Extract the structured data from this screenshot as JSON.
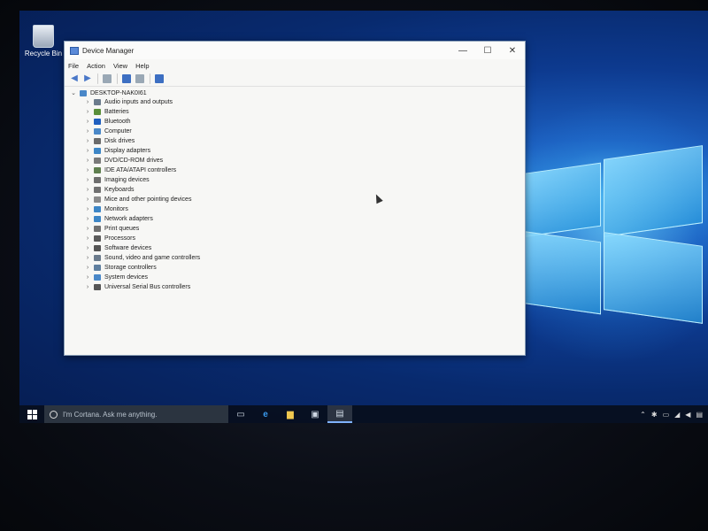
{
  "desktop": {
    "recycle_bin_label": "Recycle Bin"
  },
  "window": {
    "title": "Device Manager",
    "controls": {
      "minimize": "—",
      "maximize": "☐",
      "close": "✕"
    }
  },
  "menu": [
    "File",
    "Action",
    "View",
    "Help"
  ],
  "tree": {
    "root": "DESKTOP-NAK0I61",
    "items": [
      {
        "label": "Audio inputs and outputs",
        "icon": "speaker-icon",
        "color": "#6b7b8c"
      },
      {
        "label": "Batteries",
        "icon": "battery-icon",
        "color": "#5a8f3a"
      },
      {
        "label": "Bluetooth",
        "icon": "bluetooth-icon",
        "color": "#1f5fbf"
      },
      {
        "label": "Computer",
        "icon": "computer-icon",
        "color": "#4a88c8"
      },
      {
        "label": "Disk drives",
        "icon": "disk-icon",
        "color": "#6b6b6b"
      },
      {
        "label": "Display adapters",
        "icon": "display-icon",
        "color": "#3d86c6"
      },
      {
        "label": "DVD/CD-ROM drives",
        "icon": "dvd-icon",
        "color": "#7a7a7a"
      },
      {
        "label": "IDE ATA/ATAPI controllers",
        "icon": "ide-icon",
        "color": "#5f7f4f"
      },
      {
        "label": "Imaging devices",
        "icon": "camera-icon",
        "color": "#6d6d6d"
      },
      {
        "label": "Keyboards",
        "icon": "keyboard-icon",
        "color": "#707070"
      },
      {
        "label": "Mice and other pointing devices",
        "icon": "mouse-icon",
        "color": "#8a8a8a"
      },
      {
        "label": "Monitors",
        "icon": "monitor-icon",
        "color": "#3d86c6"
      },
      {
        "label": "Network adapters",
        "icon": "network-icon",
        "color": "#3d86c6"
      },
      {
        "label": "Print queues",
        "icon": "printer-icon",
        "color": "#707070"
      },
      {
        "label": "Processors",
        "icon": "processor-icon",
        "color": "#5a5a5a"
      },
      {
        "label": "Software devices",
        "icon": "software-icon",
        "color": "#555555"
      },
      {
        "label": "Sound, video and game controllers",
        "icon": "sound-icon",
        "color": "#6b7b8c"
      },
      {
        "label": "Storage controllers",
        "icon": "storage-icon",
        "color": "#5f7f9f"
      },
      {
        "label": "System devices",
        "icon": "system-icon",
        "color": "#4a88c8"
      },
      {
        "label": "Universal Serial Bus controllers",
        "icon": "usb-icon",
        "color": "#555555"
      }
    ]
  },
  "taskbar": {
    "cortana_placeholder": "I'm Cortana. Ask me anything."
  }
}
